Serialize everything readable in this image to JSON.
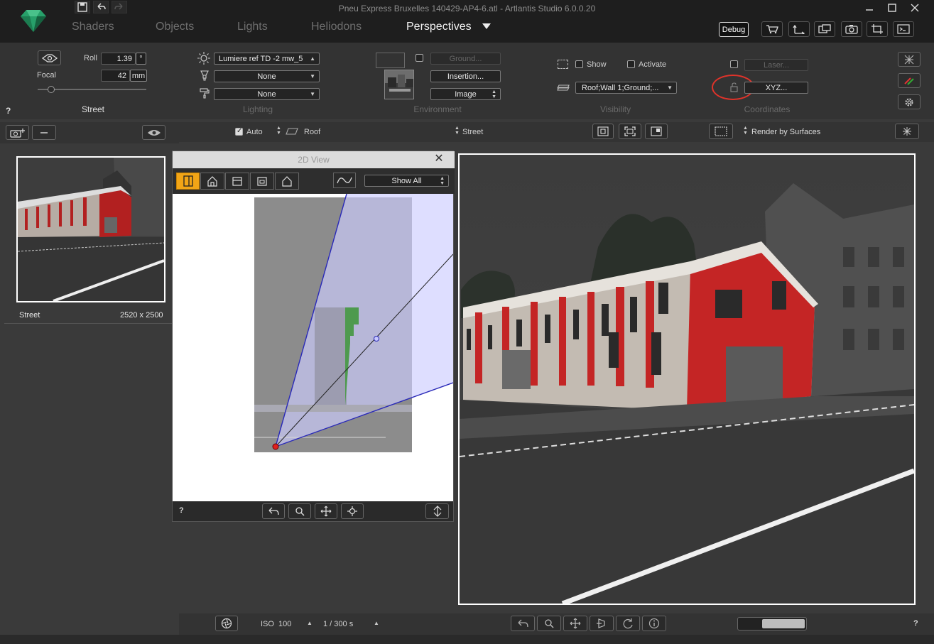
{
  "window": {
    "title": "Pneu Express Bruxelles 140429-AP4-6.atl - Artlantis Studio 6.0.0.20"
  },
  "tabs": [
    "Shaders",
    "Objects",
    "Lights",
    "Heliodons",
    "Perspectives"
  ],
  "header": {
    "debug_label": "Debug"
  },
  "camera": {
    "roll_label": "Roll",
    "roll_value": "1.39",
    "roll_unit": "°",
    "focal_label": "Focal",
    "focal_value": "42",
    "focal_unit": "mm",
    "view_name": "Street"
  },
  "lighting": {
    "light_select": "Lumiere ref TD -2 mw_5",
    "select2": "None",
    "select3": "None",
    "group_label": "Lighting"
  },
  "environment": {
    "ground": "Ground...",
    "insertion": "Insertion...",
    "image": "Image",
    "group_label": "Environment"
  },
  "visibility": {
    "show": "Show",
    "activate": "Activate",
    "layers": "Roof;Wall 1;Ground;...",
    "group_label": "Visibility"
  },
  "coordinates": {
    "laser": "Laser...",
    "xyz": "XYZ...",
    "group_label": "Coordinates"
  },
  "help": "?",
  "subbar": {
    "auto": "Auto",
    "roof": "Roof",
    "street": "Street",
    "render_mode": "Render by Surfaces"
  },
  "list": {
    "item_name": "Street",
    "item_size": "2520 x 2500"
  },
  "view2d": {
    "title": "2D View",
    "filter": "Show All",
    "help": "?"
  },
  "bottom": {
    "iso_label": "ISO",
    "iso_value": "100",
    "shutter": "1 / 300 s",
    "help": "?"
  },
  "colors": {
    "accent": "#f2a516",
    "highlight": "#e0332a",
    "camera_cone": "#2a2ab8"
  }
}
